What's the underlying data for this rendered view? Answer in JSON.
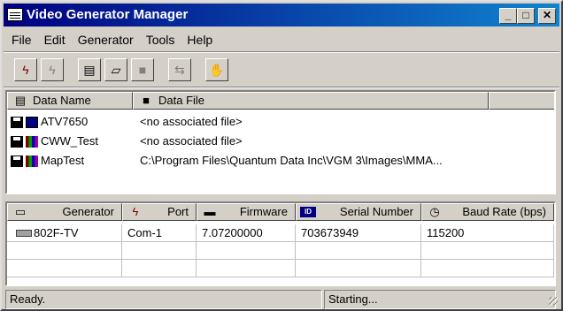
{
  "window": {
    "title": "Video Generator Manager",
    "minimize": "_",
    "maximize": "□",
    "close": "✕"
  },
  "menu": [
    {
      "label": "File"
    },
    {
      "label": "Edit"
    },
    {
      "label": "Generator"
    },
    {
      "label": "Tools"
    },
    {
      "label": "Help"
    }
  ],
  "toolbar": {
    "connect_icon": "plug-connect-icon",
    "disconnect_icon": "plug-disconnect-icon",
    "new_icon": "new-document-icon",
    "open_icon": "open-folder-icon",
    "save_icon": "save-disk-icon",
    "transfer_icon": "transfer-icon",
    "probe_icon": "hand-icon"
  },
  "data_table": {
    "columns": [
      {
        "label": "Data Name"
      },
      {
        "label": "Data File"
      }
    ],
    "rows": [
      {
        "name": "ATV7650",
        "file": "<no associated file>",
        "icon": "monitor-icon"
      },
      {
        "name": "CWW_Test",
        "file": "<no associated file>",
        "icon": "colorbars-icon"
      },
      {
        "name": "MapTest",
        "file": "C:\\Program Files\\Quantum Data Inc\\VGM 3\\Images\\MMA...",
        "icon": "colorbars-icon"
      }
    ]
  },
  "generator_table": {
    "columns": [
      {
        "label": "Generator"
      },
      {
        "label": "Port"
      },
      {
        "label": "Firmware"
      },
      {
        "label": "Serial Number"
      },
      {
        "label": "Baud Rate (bps)"
      }
    ],
    "rows": [
      {
        "generator": "802F-TV",
        "port": "Com-1",
        "firmware": "7.07200000",
        "serial": "703673949",
        "baud": "115200"
      }
    ]
  },
  "status": {
    "left": "Ready.",
    "right": "Starting..."
  }
}
